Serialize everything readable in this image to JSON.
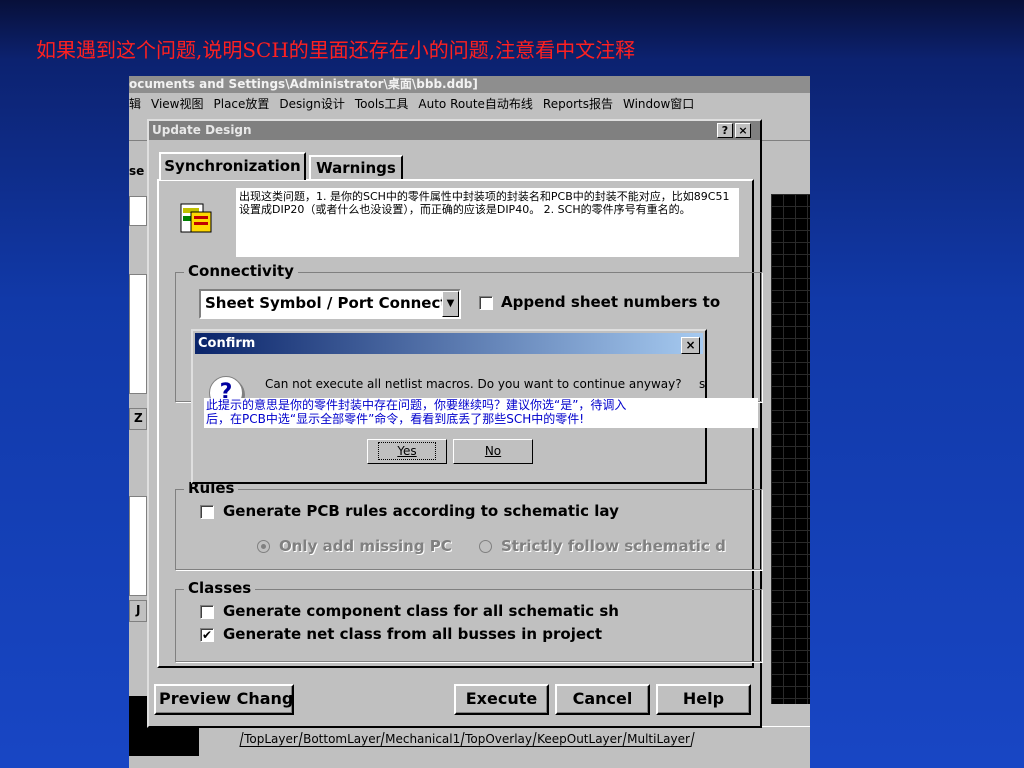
{
  "slide": {
    "title": "如果遇到这个问题,说明SCH的里面还存在小的问题,注意看中文注释"
  },
  "app": {
    "title": "ocuments and Settings\\Administrator\\桌面\\bbb.ddb]",
    "menu": [
      "辑",
      "View视图",
      "Place放置",
      "Design设计",
      "Tools工具",
      "Auto Route自动布线",
      "Reports报告",
      "Window窗口"
    ],
    "side_labels": {
      "top": "se",
      "mid": "Z",
      "bottom": "J"
    },
    "layer_tabs": [
      "TopLayer",
      "BottomLayer",
      "Mechanical1",
      "TopOverlay",
      "KeepOutLayer",
      "MultiLayer"
    ]
  },
  "update_design": {
    "title": "Update Design",
    "help_btn": "?",
    "close_btn": "×",
    "tabs": {
      "sync": "Synchronization",
      "warn": "Warnings"
    },
    "note": "出现这类问题，1. 是你的SCH中的零件属性中封装项的封装名和PCB中的封装不能对应，比如89C51设置成DIP20（或者什么也没设置），而正确的应该是DIP40。   2. SCH的零件序号有重名的。",
    "connectivity": {
      "label": "Connectivity",
      "select_value": "Sheet Symbol / Port Connect",
      "append_label": "Append sheet numbers to",
      "append_checked": false
    },
    "rules": {
      "label": "Rules",
      "generate_label": "Generate PCB rules according to schematic lay",
      "generate_checked": false,
      "opt_missing": "Only add missing PC",
      "opt_strict": "Strictly follow schematic d"
    },
    "classes": {
      "label": "Classes",
      "component_label": "Generate component class for all schematic sh",
      "component_checked": false,
      "net_label": "Generate net class from all busses in project",
      "net_checked": true
    },
    "buttons": {
      "preview": "Preview Changes",
      "execute": "Execute",
      "cancel": "Cancel",
      "help": "Help"
    }
  },
  "confirm": {
    "title": "Confirm",
    "close": "×",
    "message": "Can not execute all netlist macros. Do you want to continue anyway?",
    "partial": "s",
    "yes": "Yes",
    "no": "No",
    "annotation_line1": "此提示的意思是你的零件封装中存在问题，你要继续吗？建议你选“是”，待调入",
    "annotation_line2": "后，在PCB中选“显示全部零件”命令，看看到底丢了那些SCH中的零件!"
  }
}
